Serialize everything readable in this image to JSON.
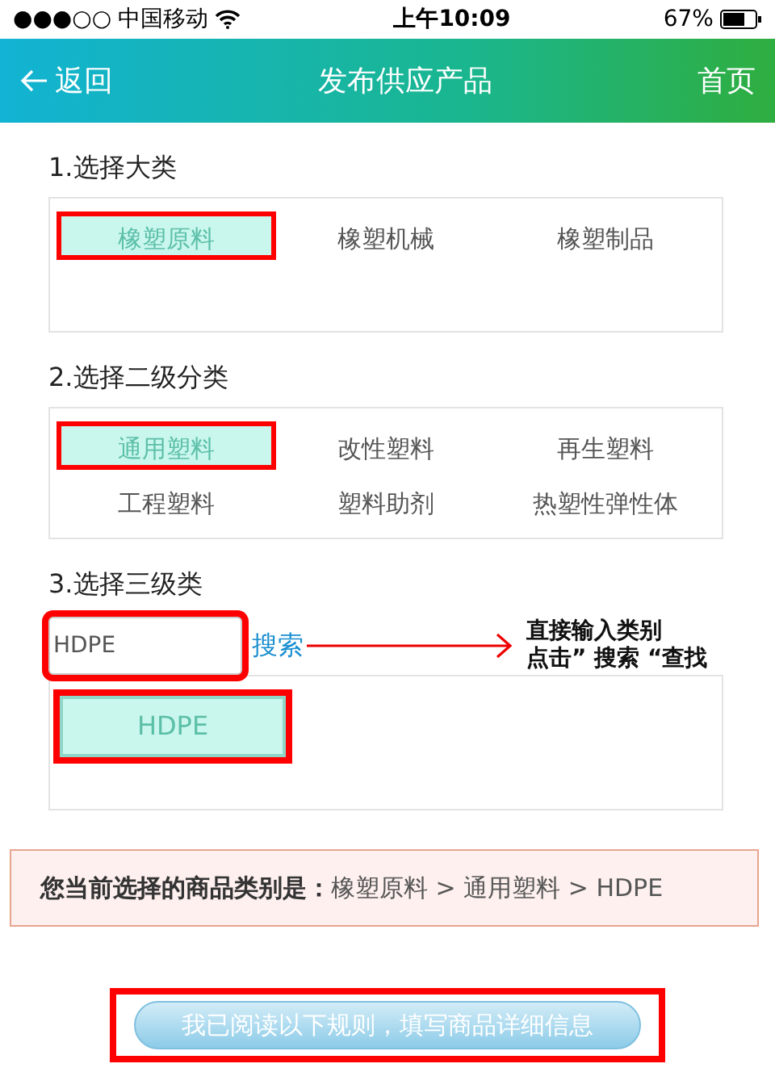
{
  "status_bar": {
    "signal": "●●●○○",
    "carrier": "中国移动",
    "time": "上午10:09",
    "battery": "67%"
  },
  "header": {
    "back": "返回",
    "title": "发布供应产品",
    "home": "首页"
  },
  "sections": [
    {
      "title": "1.选择大类",
      "options": [
        {
          "label": "橡塑原料",
          "selected": true,
          "annotated": true
        },
        {
          "label": "橡塑机械",
          "selected": false,
          "annotated": false
        },
        {
          "label": "橡塑制品",
          "selected": false,
          "annotated": false
        }
      ]
    },
    {
      "title": "2.选择二级分类",
      "options": [
        {
          "label": "通用塑料",
          "selected": true,
          "annotated": true
        },
        {
          "label": "改性塑料",
          "selected": false,
          "annotated": false
        },
        {
          "label": "再生塑料",
          "selected": false,
          "annotated": false
        },
        {
          "label": "工程塑料",
          "selected": false,
          "annotated": false
        },
        {
          "label": "塑料助剂",
          "selected": false,
          "annotated": false
        },
        {
          "label": "热塑性弹性体",
          "selected": false,
          "annotated": false
        }
      ]
    }
  ],
  "third": {
    "title": "3.选择三级类",
    "search": {
      "value": "HDPE",
      "annotated": true
    },
    "search_button": "搜索",
    "note": [
      "直接输入类别",
      "点击” 搜索 “查找"
    ],
    "results": [
      {
        "label": "HDPE",
        "selected": true,
        "annotated": true
      }
    ]
  },
  "summary": {
    "label": "您当前选择的商品类别是：",
    "path": "橡塑原料 > 通用塑料 > HDPE"
  },
  "submit": {
    "label": "我已阅读以下规则，填写商品详细信息",
    "annotated": true
  }
}
